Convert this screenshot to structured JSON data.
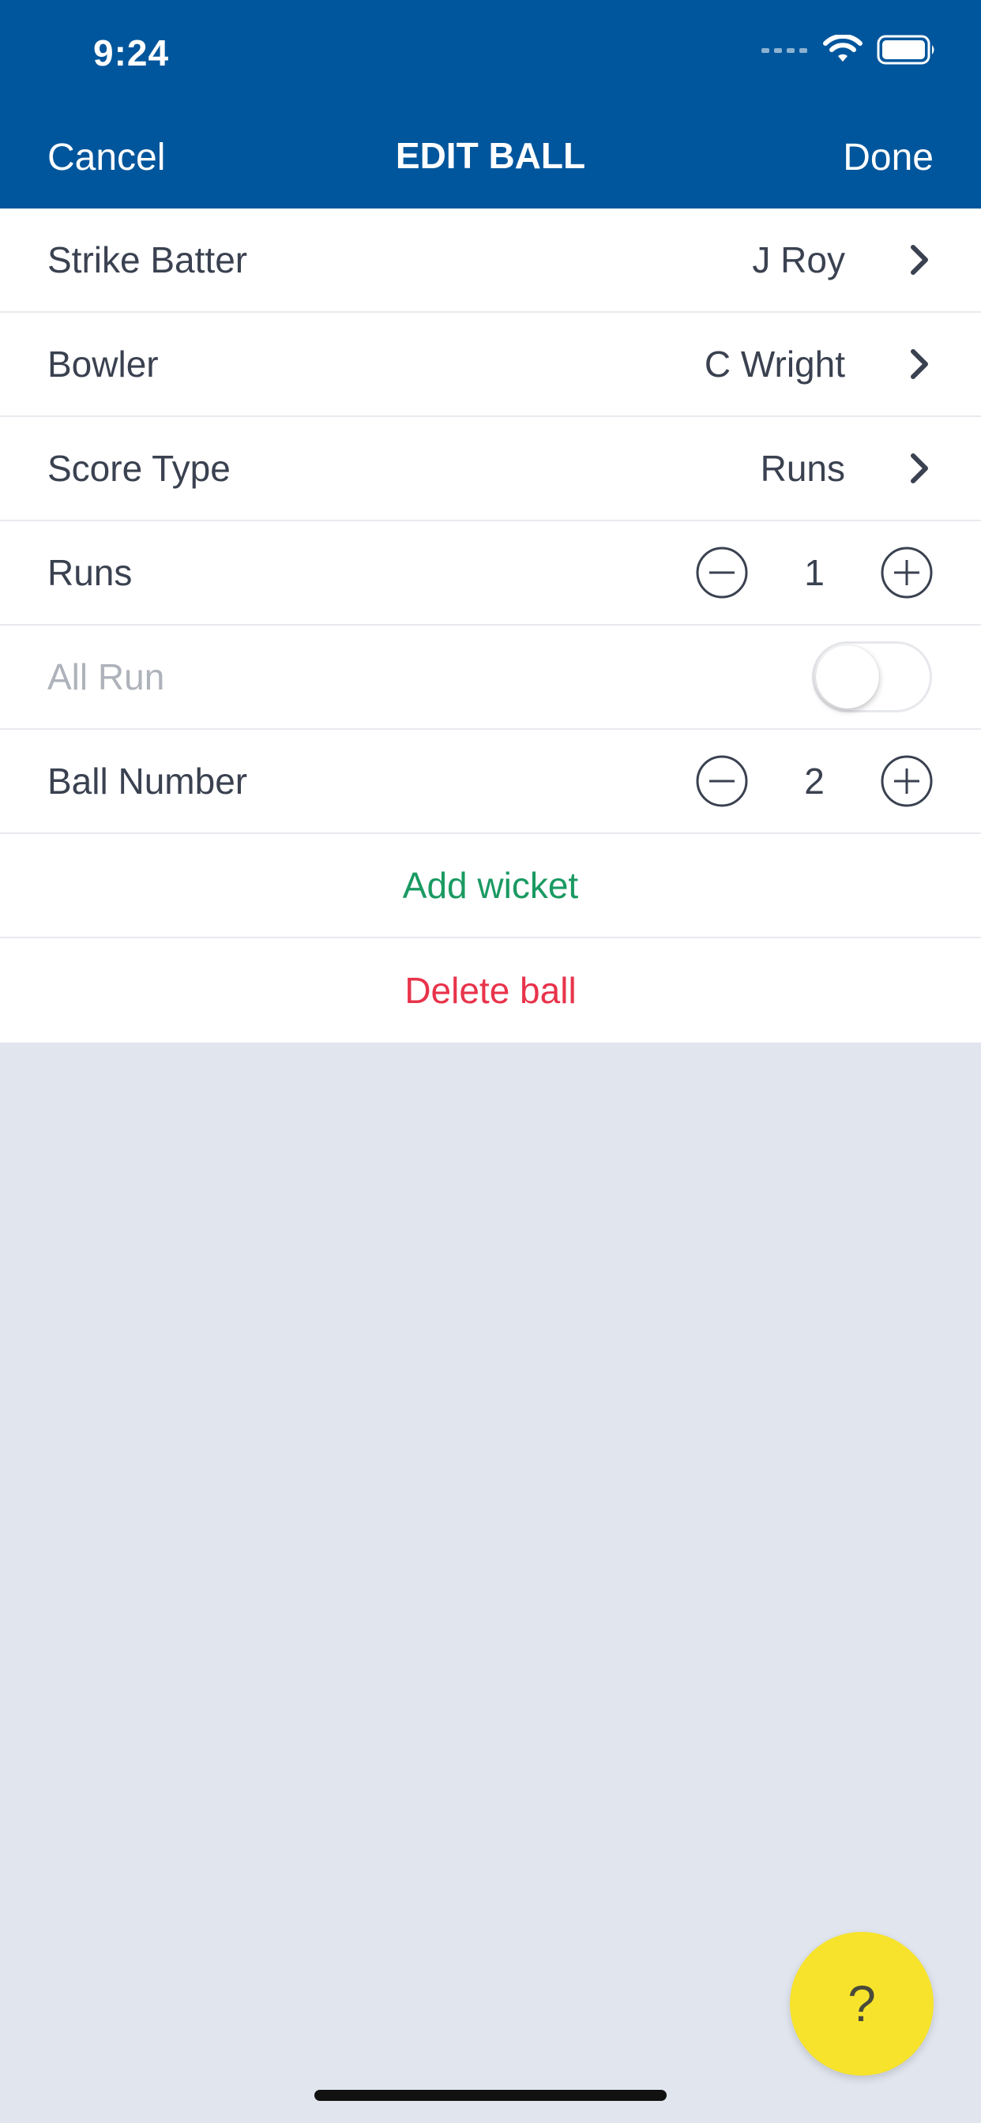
{
  "status_bar": {
    "time": "9:24"
  },
  "nav": {
    "cancel_label": "Cancel",
    "title": "EDIT BALL",
    "done_label": "Done"
  },
  "form": {
    "strike_batter": {
      "label": "Strike Batter",
      "value": "J Roy"
    },
    "bowler": {
      "label": "Bowler",
      "value": "C Wright"
    },
    "score_type": {
      "label": "Score Type",
      "value": "Runs"
    },
    "runs": {
      "label": "Runs",
      "value": "1"
    },
    "all_run": {
      "label": "All Run",
      "enabled": false
    },
    "ball_number": {
      "label": "Ball Number",
      "value": "2"
    },
    "add_wicket_label": "Add wicket",
    "delete_ball_label": "Delete ball"
  },
  "help": {
    "label": "?"
  },
  "colors": {
    "header_bg": "#00569c",
    "page_bg": "#e0e5ee",
    "add_wicket": "#1a9a62",
    "delete_ball": "#e8334a",
    "help_fab": "#f7e32b"
  },
  "icons": {
    "status": [
      "signal-icon",
      "wifi-icon",
      "battery-icon"
    ],
    "row_disclosure": "chevron-right-icon",
    "stepper": [
      "minus-circle-icon",
      "plus-circle-icon"
    ]
  }
}
